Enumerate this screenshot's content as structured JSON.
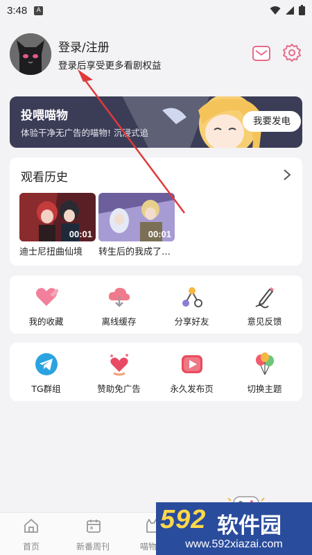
{
  "status_bar": {
    "time": "3:48",
    "notif_badge": "A"
  },
  "profile": {
    "title": "登录/注册",
    "subtitle": "登录后享受更多看剧权益",
    "mail_icon": "mail-icon",
    "settings_icon": "gear-icon"
  },
  "banner": {
    "title": "投喂喵物",
    "subtitle": "体验干净无广告的喵物! 沉浸式追",
    "button_label": "我要发电"
  },
  "history": {
    "title": "观看历史",
    "items": [
      {
        "caption": "迪士尼扭曲仙境",
        "time": "00:01"
      },
      {
        "caption": "转生后的我成了…",
        "time": "00:01"
      }
    ]
  },
  "grid_1": [
    {
      "label": "我的收藏",
      "icon": "heart-icon"
    },
    {
      "label": "离线缓存",
      "icon": "cloud-download-icon"
    },
    {
      "label": "分享好友",
      "icon": "share-icon"
    },
    {
      "label": "意见反馈",
      "icon": "feedback-pen-icon"
    }
  ],
  "grid_2": [
    {
      "label": "TG群组",
      "icon": "telegram-icon"
    },
    {
      "label": "赞助免广告",
      "icon": "sponsor-hearts-icon"
    },
    {
      "label": "永久发布页",
      "icon": "play-icon"
    },
    {
      "label": "切换主题",
      "icon": "balloons-icon"
    }
  ],
  "bottom_nav": [
    {
      "label": "首页",
      "icon": "home-icon"
    },
    {
      "label": "新番周刊",
      "icon": "calendar-icon"
    },
    {
      "label": "喵物",
      "icon": "cat-icon"
    }
  ],
  "watermark": {
    "logo": "592",
    "text": "软件园",
    "url": "www.592xiazai.com"
  },
  "colors": {
    "page_bg": "#f3f3f5",
    "banner_bg": "#3b3d57",
    "accent_pink": "#e86a8a",
    "arrow_red": "#e0393a",
    "watermark_bg": "#2a4c9c"
  }
}
